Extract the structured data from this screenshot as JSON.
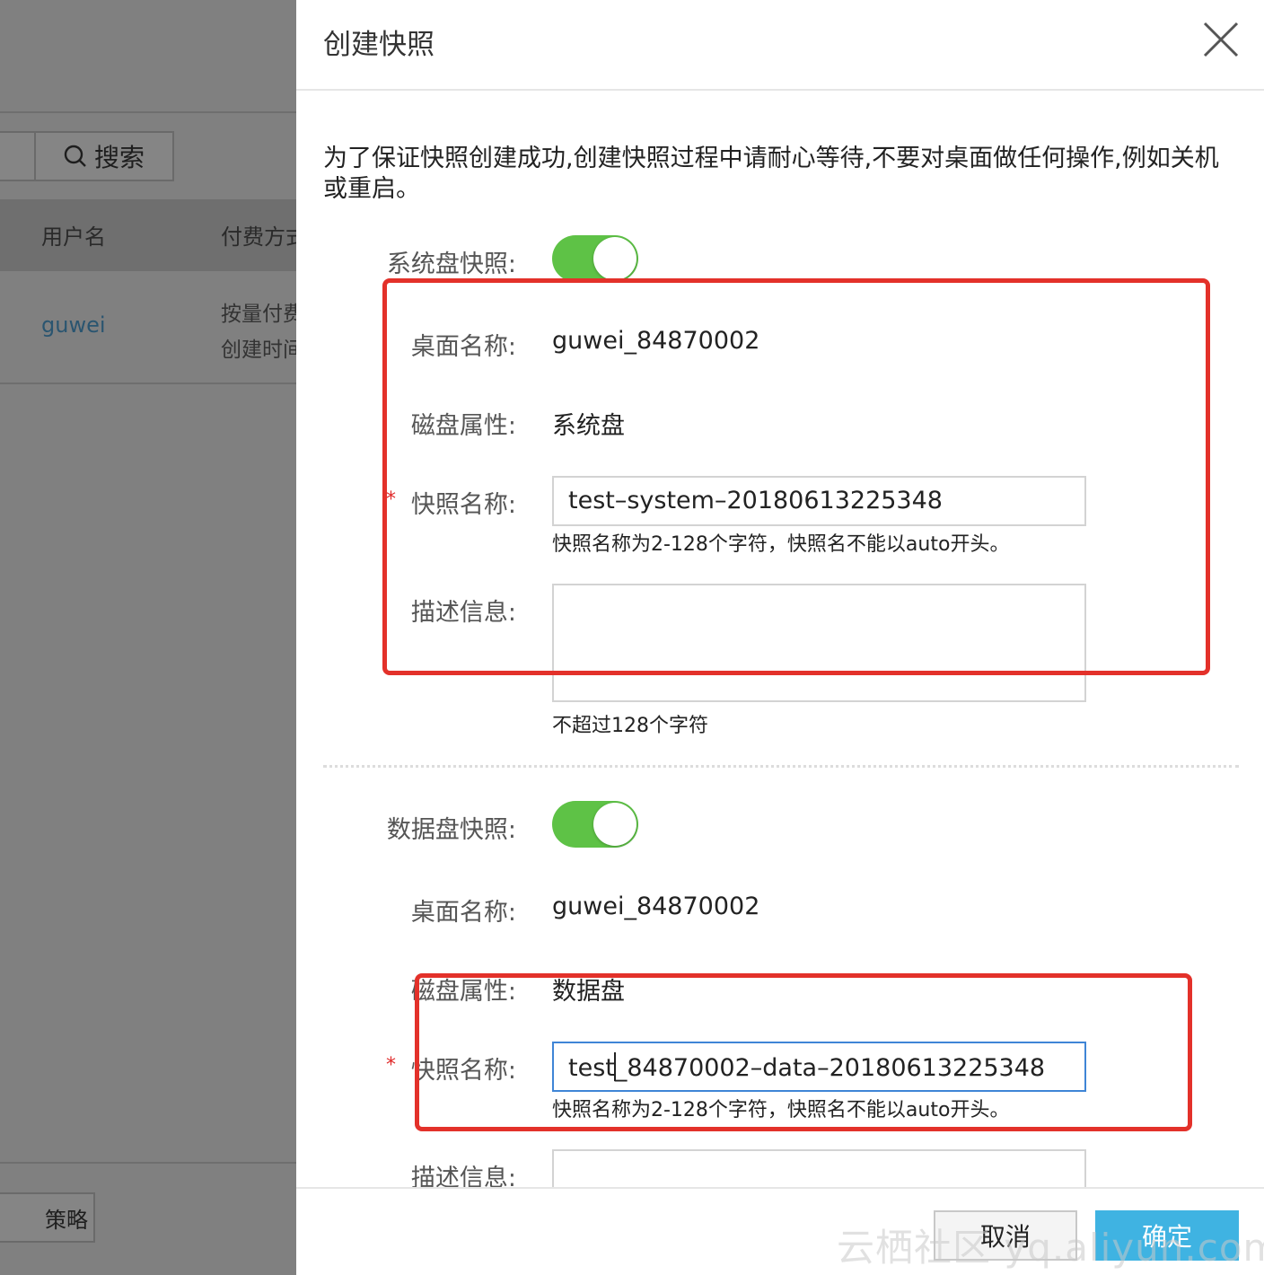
{
  "background": {
    "search_label": "搜索",
    "table_headers": [
      "用户名",
      "付费方式"
    ],
    "row": {
      "username": "guwei",
      "billing": "按量付费",
      "created": "创建时间"
    },
    "policy_button": "策略"
  },
  "dialog": {
    "title": "创建快照",
    "notice": "为了保证快照创建成功,创建快照过程中请耐心等待,不要对桌面做任何操作,例如关机或重启。",
    "system": {
      "toggle_label": "系统盘快照:",
      "toggle_on": true,
      "desktop_label": "桌面名称:",
      "desktop_value": "guwei_84870002",
      "disk_label": "磁盘属性:",
      "disk_value": "系统盘",
      "name_label": "快照名称:",
      "name_value": "test–system–20180613225348",
      "name_hint": "快照名称为2-128个字符，快照名不能以auto开头。",
      "desc_label": "描述信息:",
      "desc_value": "",
      "desc_hint": "不超过128个字符"
    },
    "data": {
      "toggle_label": "数据盘快照:",
      "toggle_on": true,
      "desktop_label": "桌面名称:",
      "desktop_value": "guwei_84870002",
      "disk_label": "磁盘属性:",
      "disk_value": "数据盘",
      "name_label": "快照名称:",
      "name_prefix": "test",
      "name_suffix": "_84870002–data–20180613225348",
      "name_hint": "快照名称为2-128个字符，快照名不能以auto开头。",
      "desc_label": "描述信息:"
    },
    "required_mark": "*",
    "cancel_label": "取消",
    "ok_label": "确定"
  },
  "watermark": "云栖社区 yq.aliyun.com",
  "colors": {
    "toggle_on": "#5ec246",
    "primary_button": "#3fb3e2",
    "annotation_red": "#e3312a",
    "required": "#e02a2a"
  }
}
